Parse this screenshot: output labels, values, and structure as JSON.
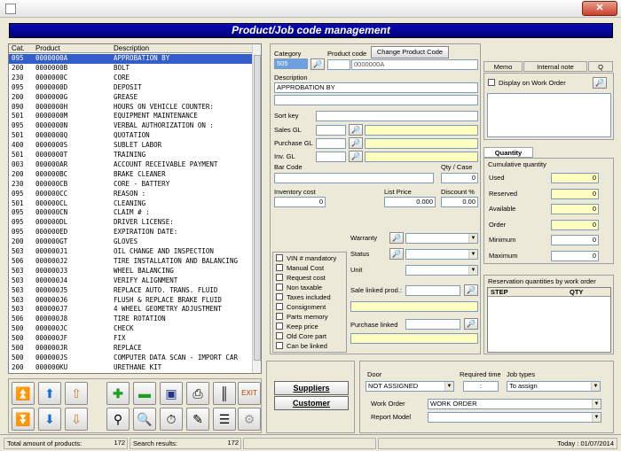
{
  "window": {
    "close_label": "✕"
  },
  "banner": {
    "title": "Product/Job code management"
  },
  "list": {
    "headers": {
      "cat": "Cat.",
      "product": "Product",
      "description": "Description"
    },
    "rows": [
      {
        "cat": "095",
        "product": "0000000A",
        "description": "APPROBATION BY"
      },
      {
        "cat": "200",
        "product": "0000000B",
        "description": "BOLT"
      },
      {
        "cat": "230",
        "product": "0000000C",
        "description": "CORE"
      },
      {
        "cat": "095",
        "product": "0000000D",
        "description": "DEPOSIT"
      },
      {
        "cat": "200",
        "product": "0000000G",
        "description": "GREASE"
      },
      {
        "cat": "090",
        "product": "0000000H",
        "description": "HOURS ON VEHICLE COUNTER:"
      },
      {
        "cat": "501",
        "product": "0000000M",
        "description": "EQUIPMENT MAINTENANCE"
      },
      {
        "cat": "095",
        "product": "0000000N",
        "description": "VERBAL AUTHORIZATION ON :"
      },
      {
        "cat": "501",
        "product": "0000000Q",
        "description": "QUOTATION"
      },
      {
        "cat": "400",
        "product": "0000000S",
        "description": "SUBLET LABOR"
      },
      {
        "cat": "501",
        "product": "0000000T",
        "description": "TRAINING"
      },
      {
        "cat": "003",
        "product": "000000AR",
        "description": "ACCOUNT RECEIVABLE PAYMENT"
      },
      {
        "cat": "200",
        "product": "000000BC",
        "description": "BRAKE CLEANER"
      },
      {
        "cat": "230",
        "product": "000000CB",
        "description": "CORE - BATTERY"
      },
      {
        "cat": "095",
        "product": "000000CC",
        "description": "REASON :"
      },
      {
        "cat": "501",
        "product": "000000CL",
        "description": "CLEANING"
      },
      {
        "cat": "095",
        "product": "000000CN",
        "description": "CLAIM # :"
      },
      {
        "cat": "095",
        "product": "000000DL",
        "description": "DRIVER LICENSE:"
      },
      {
        "cat": "095",
        "product": "000000ED",
        "description": "EXPIRATION DATE:"
      },
      {
        "cat": "200",
        "product": "000000GT",
        "description": "GLOVES"
      },
      {
        "cat": "503",
        "product": "000000J1",
        "description": "OIL CHANGE AND INSPECTION"
      },
      {
        "cat": "506",
        "product": "000000J2",
        "description": "TIRE INSTALLATION AND BALANCING"
      },
      {
        "cat": "503",
        "product": "000000J3",
        "description": "WHEEL BALANCING"
      },
      {
        "cat": "503",
        "product": "000000J4",
        "description": "VERIFY ALIGNMENT"
      },
      {
        "cat": "503",
        "product": "000000J5",
        "description": "REPLACE AUTO. TRANS. FLUID"
      },
      {
        "cat": "503",
        "product": "000000J6",
        "description": "FLUSH & REPLACE BRAKE FLUID"
      },
      {
        "cat": "503",
        "product": "000000J7",
        "description": "4 WHEEL GEOMETRY ADJUSTMENT"
      },
      {
        "cat": "506",
        "product": "000000J8",
        "description": "TIRE ROTATION"
      },
      {
        "cat": "500",
        "product": "000000JC",
        "description": "CHECK"
      },
      {
        "cat": "500",
        "product": "000000JF",
        "description": "FIX"
      },
      {
        "cat": "500",
        "product": "000000JR",
        "description": "REPLACE"
      },
      {
        "cat": "500",
        "product": "000000JS",
        "description": "COMPUTER DATA SCAN - IMPORT CAR"
      },
      {
        "cat": "200",
        "product": "000000KU",
        "description": "URETHANE KIT"
      }
    ]
  },
  "form": {
    "category_label": "Category",
    "category_value": "505",
    "product_code_label": "Product code",
    "product_code_value": "0000000A",
    "change_code_label": "Change Product Code",
    "description_label": "Description",
    "description_value": "APPROBATION BY",
    "sort_key_label": "Sort key",
    "sales_gl_label": "Sales GL",
    "purchase_gl_label": "Purchase GL",
    "inv_gl_label": "Inv. GL",
    "bar_code_label": "Bar Code",
    "qty_case_label": "Qty / Case",
    "qty_case_value": "0",
    "inventory_cost_label": "Inventory cost",
    "inventory_cost_value": "0",
    "list_price_label": "List Price",
    "list_price_value": "0.000",
    "discount_label": "Discount %",
    "discount_value": "0.00",
    "warranty_label": "Warranty",
    "status_label": "Status",
    "unit_label": "Unit",
    "sale_linked_label": "Sale linked prod.:",
    "purchase_linked_label": "Purchase linked",
    "checkboxes": [
      "VIN # mandatory",
      "Manual Cost",
      "Request cost",
      "Non taxable",
      "Taxes included",
      "Consignment",
      "Parts memory",
      "Keep price",
      "Old Core part",
      "Can be linked"
    ]
  },
  "memo": {
    "tabs": [
      "Memo",
      "Internal note",
      "Q"
    ],
    "display_label": "Display on Work Order"
  },
  "quantity": {
    "tab_label": "Quantity",
    "group_label": "Cumulative quantity",
    "items": [
      {
        "label": "Used",
        "value": "0"
      },
      {
        "label": "Reserved",
        "value": "0"
      },
      {
        "label": "Available",
        "value": "0"
      },
      {
        "label": "Order",
        "value": "0"
      },
      {
        "label": "Minimum",
        "value": "0"
      },
      {
        "label": "Maximum",
        "value": "0"
      }
    ]
  },
  "reservation": {
    "title": "Reservation quantities by work order",
    "col_step": "STEP",
    "col_qty": "QTY"
  },
  "buttons": {
    "suppliers": "Suppliers",
    "customer": "Customer"
  },
  "door": {
    "door_label": "Door",
    "door_value": "NOT ASSIGNED",
    "required_time_label": "Required time",
    "required_time_value": ":",
    "job_types_label": "Job types",
    "job_types_value": "To assign",
    "work_order_label": "Work Order",
    "work_order_value": "WORK ORDER",
    "report_model_label": "Report Model"
  },
  "status_bar": {
    "total_label": "Total amount of products:",
    "total_value": "172",
    "search_label": "Search results:",
    "search_value": "172",
    "today": "Today : 01/07/2014"
  }
}
